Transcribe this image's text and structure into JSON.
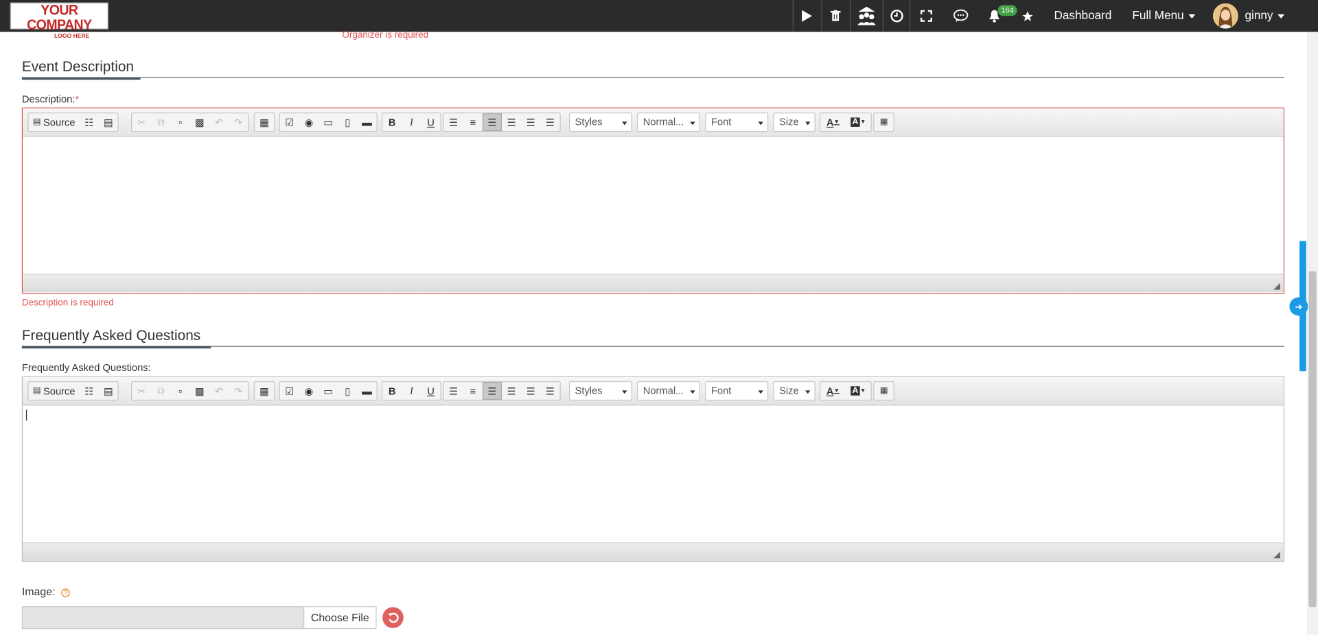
{
  "header": {
    "logo_line1": "YOUR COMPANY",
    "logo_line2": "LOGO HERE",
    "notification_count": "164",
    "dashboard": "Dashboard",
    "full_menu": "Full Menu",
    "user_name": "ginny",
    "icons": [
      "play-icon",
      "trash-icon",
      "people-icon",
      "clock-icon",
      "fullscreen-icon",
      "chat-icon",
      "bell-icon",
      "star-icon"
    ]
  },
  "errors": {
    "organizer": "Organizer is required",
    "description": "Description is required"
  },
  "sections": {
    "event_description": "Event Description",
    "faq": "Frequently Asked Questions"
  },
  "labels": {
    "description": "Description:",
    "required_mark": "*",
    "faq": "Frequently Asked Questions:",
    "image": "Image:",
    "help_mark": "?"
  },
  "editor_toolbar": {
    "source": "Source",
    "bold": "B",
    "italic": "I",
    "underline": "U",
    "styles": "Styles",
    "format": "Normal...",
    "font": "Font",
    "size": "Size",
    "text_color": "A",
    "bg_color": "A"
  },
  "file_input": {
    "button": "Choose File"
  },
  "colors": {
    "topbar": "#2b2b2b",
    "error": "#e05252",
    "accent_blue": "#1a9be6",
    "badge_green": "#43a047"
  }
}
